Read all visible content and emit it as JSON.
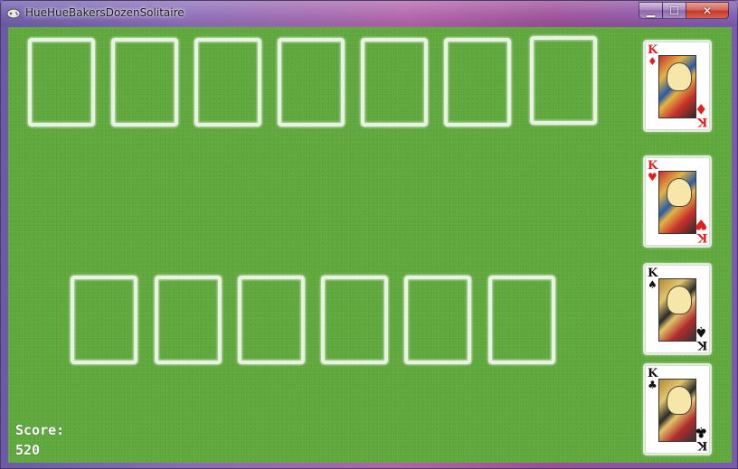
{
  "window": {
    "title": "HueHueBakersDozenSolitaire",
    "minimize_glyph": "▁",
    "maximize_glyph": "☐",
    "close_glyph": "✕"
  },
  "colors": {
    "felt": "#5fa83c",
    "red_suit": "#e0201c",
    "black_suit": "#111111"
  },
  "tableau_top_count": 7,
  "tableau_bottom_count": 6,
  "foundations": [
    {
      "rank": "K",
      "suit": "♦",
      "suit_name": "diamonds",
      "color": "red"
    },
    {
      "rank": "K",
      "suit": "♥",
      "suit_name": "hearts",
      "color": "red"
    },
    {
      "rank": "K",
      "suit": "♠",
      "suit_name": "spades",
      "color": "black"
    },
    {
      "rank": "K",
      "suit": "♣",
      "suit_name": "clubs",
      "color": "black"
    }
  ],
  "score": {
    "label": "Score:",
    "value": "520"
  }
}
